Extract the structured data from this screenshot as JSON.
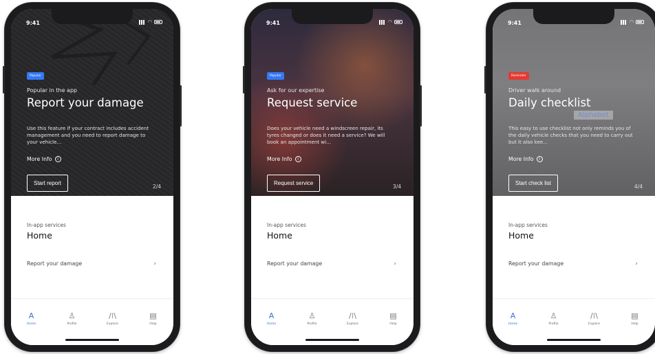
{
  "colors": {
    "accent": "#3b6fd6",
    "tag_popular": "#3478f6",
    "tag_reminder": "#e53935"
  },
  "phones": [
    {
      "status": {
        "time": "9:41"
      },
      "hero": {
        "tag": "Popular",
        "kicker": "Popular in the app",
        "title": "Report your damage",
        "description": "Use this feature if your contract includes accident management and you need to report damage to your vehicle...",
        "more_info": "More Info",
        "button": "Start report",
        "pager": "2/4"
      },
      "section": {
        "kicker": "In-app services",
        "title": "Home",
        "row": "Report your damage"
      },
      "tabs": [
        {
          "label": "Home",
          "icon": "home-icon"
        },
        {
          "label": "Profile",
          "icon": "profile-icon"
        },
        {
          "label": "Explore",
          "icon": "explore-icon"
        },
        {
          "label": "Help",
          "icon": "help-icon"
        }
      ]
    },
    {
      "status": {
        "time": "9:41"
      },
      "hero": {
        "tag": "Popular",
        "kicker": "Ask for our expertise",
        "title": "Request service",
        "description": "Does your vehicle need a windscreen repair, its tyres changed or does it need a service? We will book an appointment wi...",
        "more_info": "More Info",
        "button": "Request service",
        "pager": "3/4"
      },
      "section": {
        "kicker": "In-app services",
        "title": "Home",
        "row": "Report your damage"
      },
      "tabs": [
        {
          "label": "Home",
          "icon": "home-icon"
        },
        {
          "label": "Profile",
          "icon": "profile-icon"
        },
        {
          "label": "Explore",
          "icon": "explore-icon"
        },
        {
          "label": "Help",
          "icon": "help-icon"
        }
      ]
    },
    {
      "status": {
        "time": "9:41"
      },
      "hero": {
        "tag": "Reminder",
        "kicker": "Driver walk around",
        "title": "Daily checklist",
        "description": "This easy to use checklist not only reminds you of the daily vehicle checks that you need to carry out but it also kee...",
        "more_info": "More Info",
        "button": "Start check list",
        "pager": "4/4",
        "van_logo": "Alphabet"
      },
      "section": {
        "kicker": "In-app services",
        "title": "Home",
        "row": "Report your damage"
      },
      "tabs": [
        {
          "label": "Home",
          "icon": "home-icon"
        },
        {
          "label": "Profile",
          "icon": "profile-icon"
        },
        {
          "label": "Explore",
          "icon": "explore-icon"
        },
        {
          "label": "Help",
          "icon": "help-icon"
        }
      ]
    }
  ]
}
